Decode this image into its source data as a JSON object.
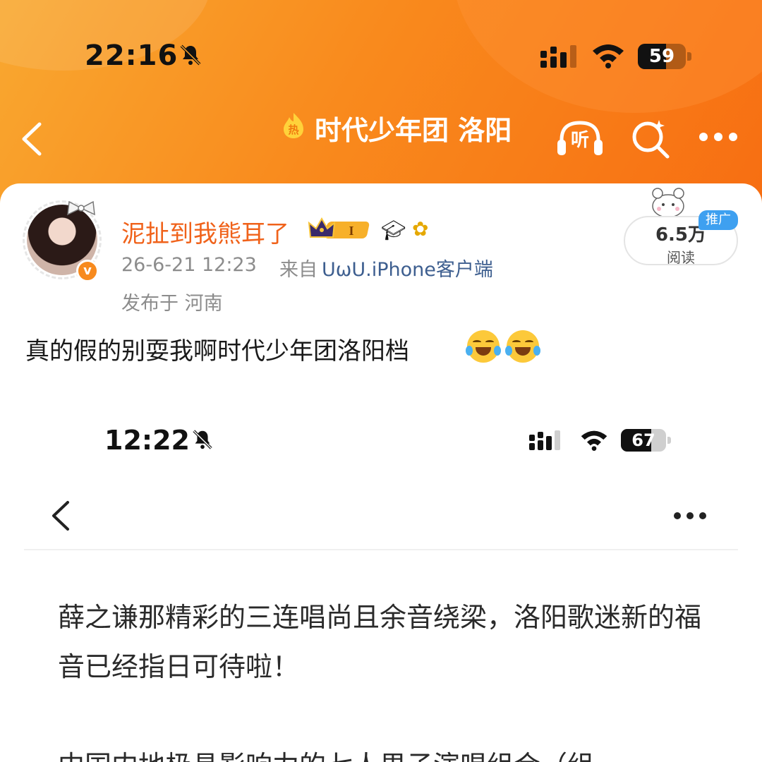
{
  "status_bar": {
    "time": "22:16",
    "battery": "59",
    "battery_level": 0.59
  },
  "nav": {
    "title": "时代少年团 洛阳",
    "hot_badge": "热",
    "listen_label": "听"
  },
  "post": {
    "username": "泥扯到我熊耳了",
    "level_badge": "I",
    "time": "26-6-21 12:23",
    "from_label": "来自",
    "source": "ᑌωᑌ.iPhone客户端",
    "location": "发布于 河南",
    "read_count": "6.5万",
    "read_label": "阅读",
    "promo_tag": "推广",
    "text": "真的假的别耍我啊时代少年团洛阳档",
    "emoji_name": "laugh-cry-emoji"
  },
  "embedded": {
    "time": "12:22",
    "battery": "67",
    "battery_level": 0.67,
    "para1": "薛之谦那精彩的三连唱尚且余音绕梁，洛阳歌迷新的福音已经指日可待啦！",
    "para2": "中国内地极具影响力的七人男子演唱组合（组"
  },
  "colors": {
    "accent": "#f98a1d",
    "username": "#f0621a",
    "link": "#3d5e8f",
    "promo": "#3ea0f0"
  }
}
